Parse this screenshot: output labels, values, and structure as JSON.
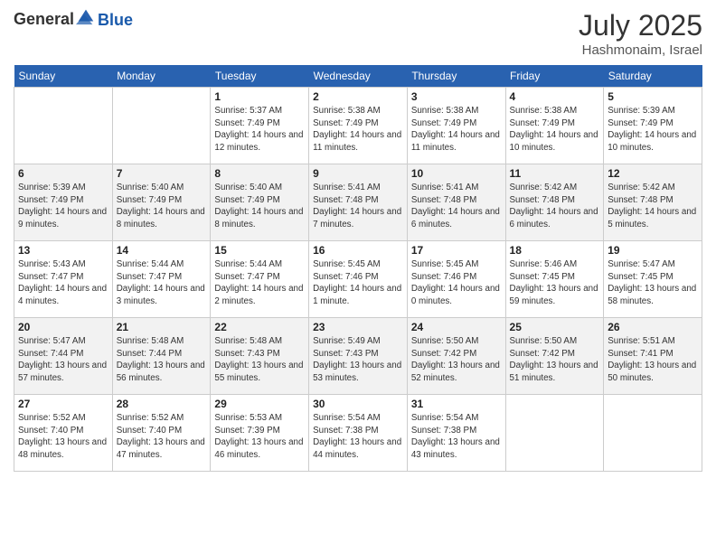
{
  "logo": {
    "text_general": "General",
    "text_blue": "Blue"
  },
  "title": "July 2025",
  "subtitle": "Hashmonaim, Israel",
  "days_of_week": [
    "Sunday",
    "Monday",
    "Tuesday",
    "Wednesday",
    "Thursday",
    "Friday",
    "Saturday"
  ],
  "weeks": [
    [
      {
        "day": "",
        "info": ""
      },
      {
        "day": "",
        "info": ""
      },
      {
        "day": "1",
        "info": "Sunrise: 5:37 AM\nSunset: 7:49 PM\nDaylight: 14 hours and 12 minutes."
      },
      {
        "day": "2",
        "info": "Sunrise: 5:38 AM\nSunset: 7:49 PM\nDaylight: 14 hours and 11 minutes."
      },
      {
        "day": "3",
        "info": "Sunrise: 5:38 AM\nSunset: 7:49 PM\nDaylight: 14 hours and 11 minutes."
      },
      {
        "day": "4",
        "info": "Sunrise: 5:38 AM\nSunset: 7:49 PM\nDaylight: 14 hours and 10 minutes."
      },
      {
        "day": "5",
        "info": "Sunrise: 5:39 AM\nSunset: 7:49 PM\nDaylight: 14 hours and 10 minutes."
      }
    ],
    [
      {
        "day": "6",
        "info": "Sunrise: 5:39 AM\nSunset: 7:49 PM\nDaylight: 14 hours and 9 minutes."
      },
      {
        "day": "7",
        "info": "Sunrise: 5:40 AM\nSunset: 7:49 PM\nDaylight: 14 hours and 8 minutes."
      },
      {
        "day": "8",
        "info": "Sunrise: 5:40 AM\nSunset: 7:49 PM\nDaylight: 14 hours and 8 minutes."
      },
      {
        "day": "9",
        "info": "Sunrise: 5:41 AM\nSunset: 7:48 PM\nDaylight: 14 hours and 7 minutes."
      },
      {
        "day": "10",
        "info": "Sunrise: 5:41 AM\nSunset: 7:48 PM\nDaylight: 14 hours and 6 minutes."
      },
      {
        "day": "11",
        "info": "Sunrise: 5:42 AM\nSunset: 7:48 PM\nDaylight: 14 hours and 6 minutes."
      },
      {
        "day": "12",
        "info": "Sunrise: 5:42 AM\nSunset: 7:48 PM\nDaylight: 14 hours and 5 minutes."
      }
    ],
    [
      {
        "day": "13",
        "info": "Sunrise: 5:43 AM\nSunset: 7:47 PM\nDaylight: 14 hours and 4 minutes."
      },
      {
        "day": "14",
        "info": "Sunrise: 5:44 AM\nSunset: 7:47 PM\nDaylight: 14 hours and 3 minutes."
      },
      {
        "day": "15",
        "info": "Sunrise: 5:44 AM\nSunset: 7:47 PM\nDaylight: 14 hours and 2 minutes."
      },
      {
        "day": "16",
        "info": "Sunrise: 5:45 AM\nSunset: 7:46 PM\nDaylight: 14 hours and 1 minute."
      },
      {
        "day": "17",
        "info": "Sunrise: 5:45 AM\nSunset: 7:46 PM\nDaylight: 14 hours and 0 minutes."
      },
      {
        "day": "18",
        "info": "Sunrise: 5:46 AM\nSunset: 7:45 PM\nDaylight: 13 hours and 59 minutes."
      },
      {
        "day": "19",
        "info": "Sunrise: 5:47 AM\nSunset: 7:45 PM\nDaylight: 13 hours and 58 minutes."
      }
    ],
    [
      {
        "day": "20",
        "info": "Sunrise: 5:47 AM\nSunset: 7:44 PM\nDaylight: 13 hours and 57 minutes."
      },
      {
        "day": "21",
        "info": "Sunrise: 5:48 AM\nSunset: 7:44 PM\nDaylight: 13 hours and 56 minutes."
      },
      {
        "day": "22",
        "info": "Sunrise: 5:48 AM\nSunset: 7:43 PM\nDaylight: 13 hours and 55 minutes."
      },
      {
        "day": "23",
        "info": "Sunrise: 5:49 AM\nSunset: 7:43 PM\nDaylight: 13 hours and 53 minutes."
      },
      {
        "day": "24",
        "info": "Sunrise: 5:50 AM\nSunset: 7:42 PM\nDaylight: 13 hours and 52 minutes."
      },
      {
        "day": "25",
        "info": "Sunrise: 5:50 AM\nSunset: 7:42 PM\nDaylight: 13 hours and 51 minutes."
      },
      {
        "day": "26",
        "info": "Sunrise: 5:51 AM\nSunset: 7:41 PM\nDaylight: 13 hours and 50 minutes."
      }
    ],
    [
      {
        "day": "27",
        "info": "Sunrise: 5:52 AM\nSunset: 7:40 PM\nDaylight: 13 hours and 48 minutes."
      },
      {
        "day": "28",
        "info": "Sunrise: 5:52 AM\nSunset: 7:40 PM\nDaylight: 13 hours and 47 minutes."
      },
      {
        "day": "29",
        "info": "Sunrise: 5:53 AM\nSunset: 7:39 PM\nDaylight: 13 hours and 46 minutes."
      },
      {
        "day": "30",
        "info": "Sunrise: 5:54 AM\nSunset: 7:38 PM\nDaylight: 13 hours and 44 minutes."
      },
      {
        "day": "31",
        "info": "Sunrise: 5:54 AM\nSunset: 7:38 PM\nDaylight: 13 hours and 43 minutes."
      },
      {
        "day": "",
        "info": ""
      },
      {
        "day": "",
        "info": ""
      }
    ]
  ],
  "row_classes": [
    "row-white",
    "row-shaded",
    "row-white",
    "row-shaded",
    "row-white"
  ]
}
